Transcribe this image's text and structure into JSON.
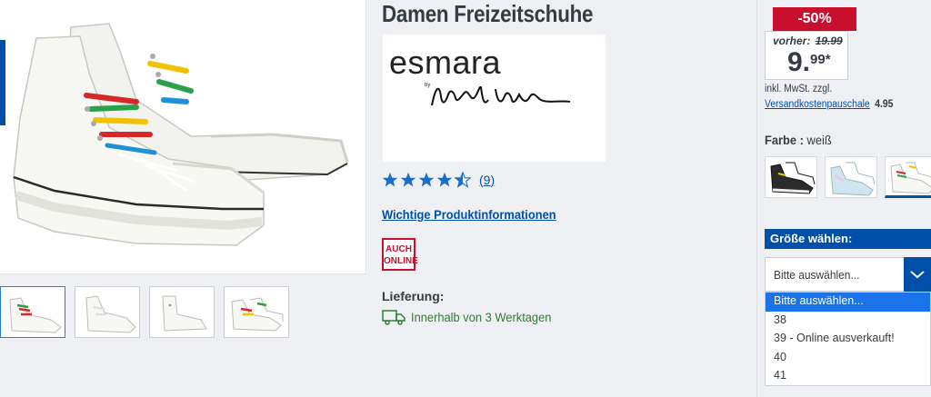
{
  "product": {
    "title": "Damen Freizeitschuhe",
    "brand": {
      "name": "esmara",
      "by": "by",
      "signature": "Heidi Klum"
    },
    "rating": {
      "stars": 4.5,
      "count": "9",
      "open_paren": "(",
      "close_paren": ")"
    },
    "info_link": "Wichtige Produktinformationen",
    "badge": {
      "line1": "AUCH",
      "line2": "ONLINE"
    },
    "delivery": {
      "label": "Lieferung:",
      "text": "Innerhalb von 3 Werktagen"
    }
  },
  "gallery": {
    "thumbnails": [
      "shoe-rainbow-laces",
      "shoe-white-laces",
      "shoe-top-view",
      "shoe-pair-rainbow"
    ],
    "active_index": 0
  },
  "price": {
    "discount": "-50%",
    "previous_label": "vorher:",
    "previous_value": "19.99",
    "current_main": "9.",
    "current_sup": "99*",
    "tax_note": "inkl. MwSt. zzgl.",
    "shipping_link": "Versandkostenpauschale",
    "shipping_cost": "4.95"
  },
  "color": {
    "label": "Farbe",
    "separator": ":",
    "value": "weiß",
    "swatches": [
      "black",
      "holographic",
      "white-rainbow"
    ],
    "active_index": 2
  },
  "size": {
    "header": "Größe wählen:",
    "selected": "Bitte auswählen...",
    "options": [
      "Bitte auswählen...",
      "38",
      "39 - Online ausverkauft!",
      "40",
      "41"
    ]
  },
  "colors": {
    "accent_blue": "#0050aa",
    "sale_red": "#c8102e",
    "delivery_green": "#2e7d32",
    "star_blue": "#1a6fc4"
  }
}
